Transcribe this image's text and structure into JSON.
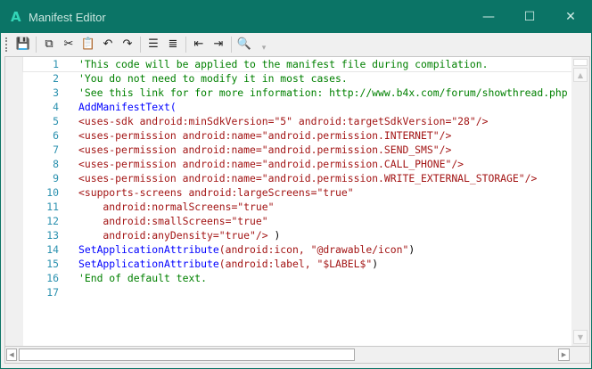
{
  "window": {
    "title": "Manifest Editor",
    "app_icon": "A",
    "minimize": "—",
    "maximize": "☐",
    "close": "✕"
  },
  "toolbar": [
    {
      "name": "save-icon",
      "glyph": "💾"
    },
    {
      "sep": true
    },
    {
      "name": "copy-icon",
      "glyph": "⧉"
    },
    {
      "name": "cut-icon",
      "glyph": "✂"
    },
    {
      "name": "paste-icon",
      "glyph": "📋"
    },
    {
      "name": "undo-icon",
      "glyph": "↶"
    },
    {
      "name": "redo-icon",
      "glyph": "↷"
    },
    {
      "sep": true
    },
    {
      "name": "comment-block-icon",
      "glyph": "☰"
    },
    {
      "name": "uncomment-block-icon",
      "glyph": "≣"
    },
    {
      "sep": true
    },
    {
      "name": "outdent-icon",
      "glyph": "⇤"
    },
    {
      "name": "indent-icon",
      "glyph": "⇥"
    },
    {
      "sep": true
    },
    {
      "name": "find-icon",
      "glyph": "🔍"
    },
    {
      "name": "overflow-chevron-icon",
      "glyph": "▾"
    }
  ],
  "colors": {
    "titlebar": "#0b7466",
    "comment": "#008000",
    "keyword": "#0000ff",
    "attribute": "#a31515",
    "line_number": "#2b91af"
  },
  "code_lines": [
    [
      {
        "t": "'This code will be applied to the manifest file during compilation.",
        "c": "c"
      }
    ],
    [
      {
        "t": "'You do not need to modify it in most cases.",
        "c": "c"
      }
    ],
    [
      {
        "t": "'See this link for for more information: http://www.b4x.com/forum/showthread.php",
        "c": "c"
      }
    ],
    [
      {
        "t": "AddManifestText(",
        "c": "k"
      }
    ],
    [
      {
        "t": "<uses-sdk android:minSdkVersion=\"5\" android:targetSdkVersion=\"28\"/>",
        "c": "a"
      }
    ],
    [
      {
        "t": "<uses-permission android:name=\"android.permission.INTERNET\"/>",
        "c": "a"
      }
    ],
    [
      {
        "t": "<uses-permission android:name=\"android.permission.SEND_SMS\"/>",
        "c": "a"
      }
    ],
    [
      {
        "t": "<uses-permission android:name=\"android.permission.CALL_PHONE\"/>",
        "c": "a"
      }
    ],
    [
      {
        "t": "<uses-permission android:name=\"android.permission.WRITE_EXTERNAL_STORAGE\"/>",
        "c": "a"
      }
    ],
    [
      {
        "t": "<supports-screens android:largeScreens=\"true\"",
        "c": "a"
      }
    ],
    [
      {
        "t": "    android:normalScreens=\"true\"",
        "c": "a"
      }
    ],
    [
      {
        "t": "    android:smallScreens=\"true\"",
        "c": "a"
      }
    ],
    [
      {
        "t": "    android:anyDensity=\"true\"/>",
        "c": "a"
      },
      {
        "t": " )",
        "c": "p"
      }
    ],
    [
      {
        "t": "SetApplicationAttribute",
        "c": "k"
      },
      {
        "t": "(android:icon, \"@drawable/icon\"",
        "c": "a"
      },
      {
        "t": ")",
        "c": "p"
      }
    ],
    [
      {
        "t": "SetApplicationAttribute",
        "c": "k"
      },
      {
        "t": "(android:label, \"$LABEL$\"",
        "c": "a"
      },
      {
        "t": ")",
        "c": "p"
      }
    ],
    [
      {
        "t": "'End of default text.",
        "c": "c"
      }
    ],
    []
  ],
  "scroll": {
    "up": "▲",
    "down": "▼",
    "left": "◀",
    "right": "▶"
  }
}
